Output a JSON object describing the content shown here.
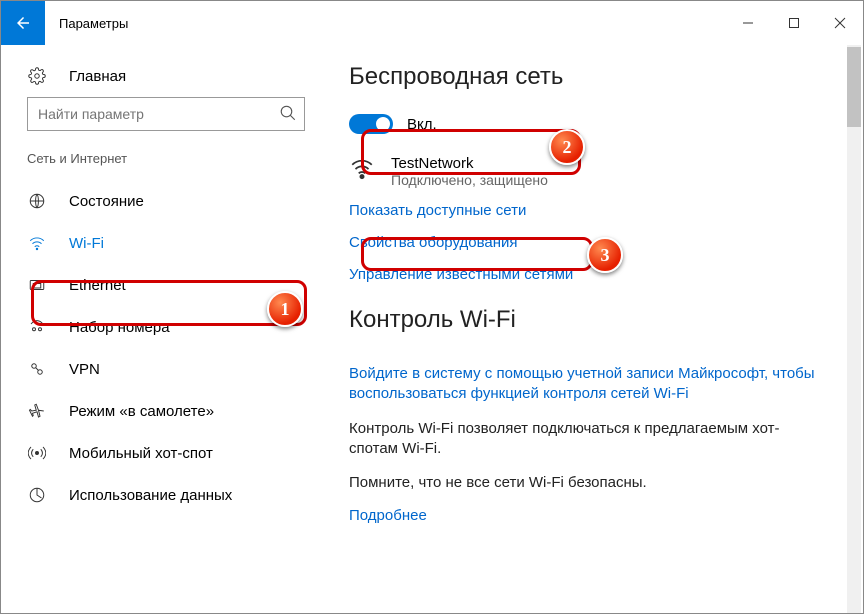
{
  "window": {
    "title": "Параметры"
  },
  "sidebar": {
    "home_label": "Главная",
    "search_placeholder": "Найти параметр",
    "section_label": "Сеть и Интернет",
    "items": [
      {
        "label": "Состояние"
      },
      {
        "label": "Wi-Fi"
      },
      {
        "label": "Ethernet"
      },
      {
        "label": "Набор номера"
      },
      {
        "label": "VPN"
      },
      {
        "label": "Режим «в самолете»"
      },
      {
        "label": "Мобильный хот-спот"
      },
      {
        "label": "Использование данных"
      }
    ]
  },
  "content": {
    "heading1": "Беспроводная сеть",
    "toggle_label": "Вкл.",
    "network": {
      "name": "TestNetwork",
      "status": "Подключено, защищено"
    },
    "link_show_networks": "Показать доступные сети",
    "link_hw_props": "Свойства оборудования",
    "link_manage_known": "Управление известными сетями",
    "heading2": "Контроль Wi-Fi",
    "link_signin": "Войдите в систему с помощью учетной записи Майкрософт, чтобы воспользоваться функцией контроля сетей Wi-Fi",
    "para1": "Контроль Wi-Fi позволяет подключаться к предлагаемым хот-спотам Wi-Fi.",
    "para2": "Помните, что не все сети Wi-Fi безопасны.",
    "link_more": "Подробнее"
  },
  "annotations": {
    "b1": "1",
    "b2": "2",
    "b3": "3"
  }
}
